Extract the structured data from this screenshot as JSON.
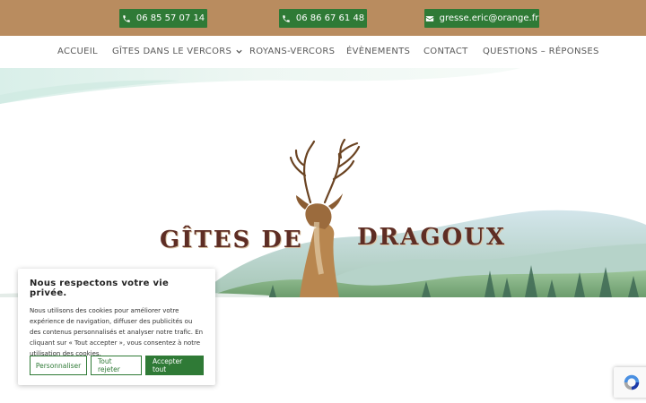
{
  "topbar": {
    "contacts": [
      {
        "label": "06 85 57 07 14",
        "icon": "phone-icon"
      },
      {
        "label": "06 86 67 61 48",
        "icon": "phone-icon"
      },
      {
        "label": "gresse.eric@orange.fr",
        "icon": "envelope-icon"
      }
    ]
  },
  "nav": {
    "items": [
      {
        "label": "ACCUEIL"
      },
      {
        "label": "GÎTES DANS LE VERCORS",
        "has_dropdown": true
      },
      {
        "label": "ROYANS-VERCORS"
      },
      {
        "label": "ÉVÈNEMENTS"
      },
      {
        "label": "CONTACT"
      },
      {
        "label": "QUESTIONS – RÉPONSES"
      }
    ]
  },
  "hero": {
    "title_left": "GÎTES DE",
    "title_right": "DRAGOUX"
  },
  "cookie": {
    "title": "Nous respectons votre vie privée.",
    "text": "Nous utilisons des cookies pour améliorer votre expérience de navigation, diffuser des publicités ou des contenus personnalisés et analyser notre trafic. En cliquant sur « Tout accepter », vous consentez à notre utilisation des cookies.",
    "customize_label": "Personnaliser",
    "reject_label": "Tout rejeter",
    "accept_label": "Accepter tout"
  },
  "colors": {
    "topbar": "#b98c5f",
    "button_green": "#2f7a36",
    "title_brown": "#5e2d24"
  }
}
